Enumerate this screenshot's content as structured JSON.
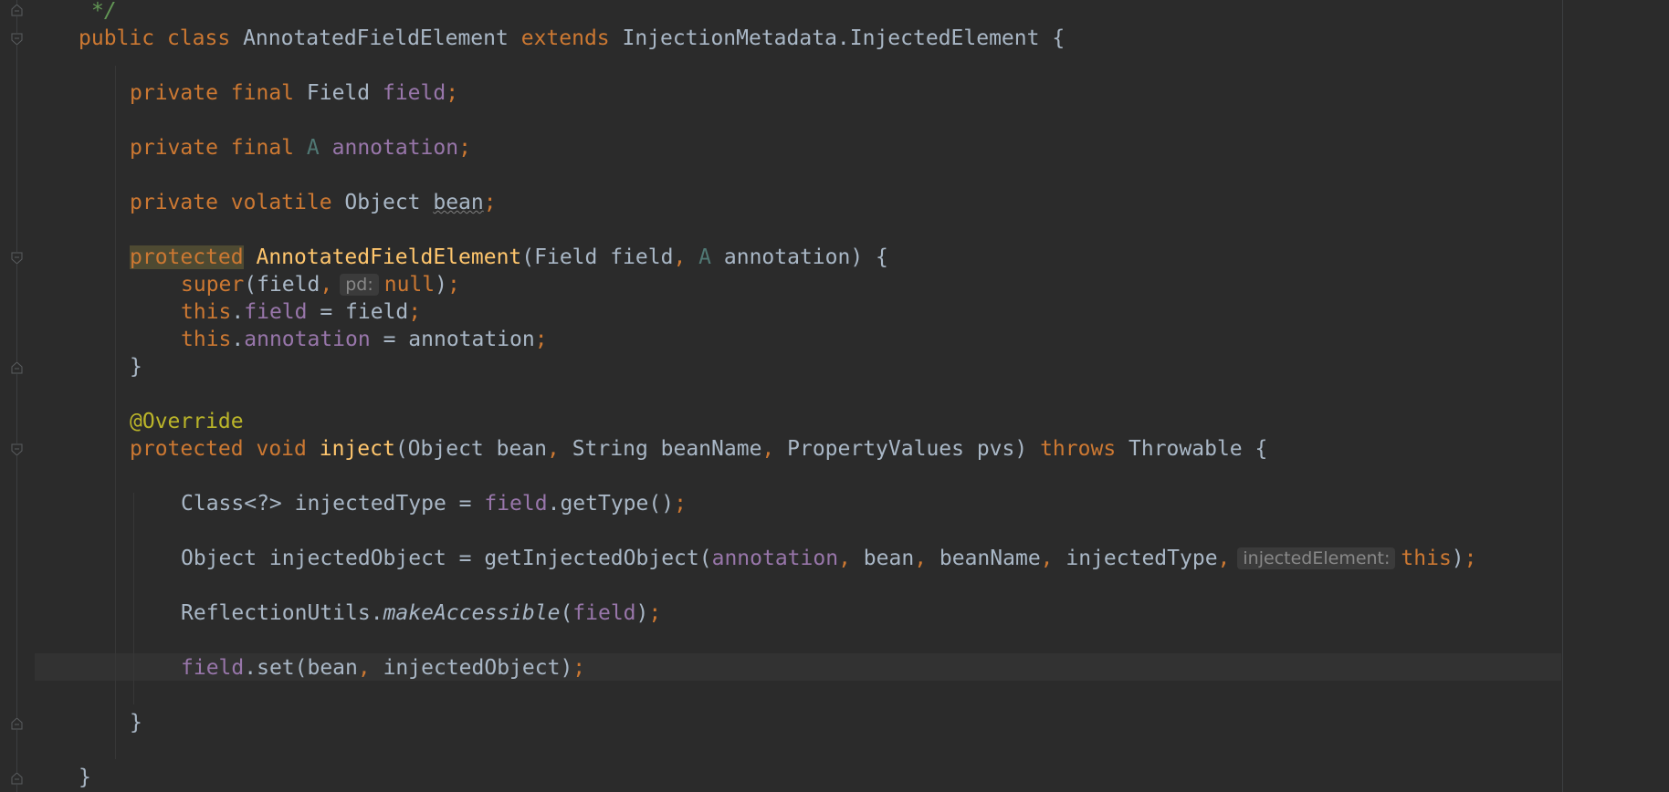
{
  "editor": {
    "lines": [
      {
        "id": "line-comment-end",
        "tokens": [
          {
            "t": "*/",
            "c": "cm"
          }
        ]
      },
      {
        "id": "line-class-decl",
        "tokens": [
          {
            "t": "public",
            "c": "kw"
          },
          {
            "t": " "
          },
          {
            "t": "class",
            "c": "kw"
          },
          {
            "t": " "
          },
          {
            "t": "AnnotatedFieldElement"
          },
          {
            "t": " "
          },
          {
            "t": "extends",
            "c": "kw"
          },
          {
            "t": " "
          },
          {
            "t": "InjectionMetadata.InjectedElement {"
          }
        ]
      },
      {
        "id": "line-field-field",
        "tokens": [
          {
            "t": "private",
            "c": "kw"
          },
          {
            "t": " "
          },
          {
            "t": "final",
            "c": "kw"
          },
          {
            "t": " Field "
          },
          {
            "t": "field",
            "c": "fld"
          },
          {
            "t": ";",
            "c": "kw"
          }
        ]
      },
      {
        "id": "line-field-annotation",
        "tokens": [
          {
            "t": "private",
            "c": "kw"
          },
          {
            "t": " "
          },
          {
            "t": "final",
            "c": "kw"
          },
          {
            "t": " "
          },
          {
            "t": "A",
            "c": "tp"
          },
          {
            "t": " "
          },
          {
            "t": "annotation",
            "c": "fld"
          },
          {
            "t": ";",
            "c": "kw"
          }
        ]
      },
      {
        "id": "line-field-bean",
        "tokens": [
          {
            "t": "private",
            "c": "kw"
          },
          {
            "t": " "
          },
          {
            "t": "volatile",
            "c": "kw"
          },
          {
            "t": " Object "
          },
          {
            "t": "bean",
            "c": "squig"
          },
          {
            "t": ";",
            "c": "kw"
          }
        ]
      },
      {
        "id": "line-constructor-decl",
        "tokens": [
          {
            "t": "protected",
            "c": "kw hl"
          },
          {
            "t": " "
          },
          {
            "t": "AnnotatedFieldElement",
            "c": "fn"
          },
          {
            "t": "(Field field"
          },
          {
            "t": ",",
            "c": "kw"
          },
          {
            "t": " "
          },
          {
            "t": "A",
            "c": "tp"
          },
          {
            "t": " annotation) {"
          }
        ]
      },
      {
        "id": "line-super-call",
        "tokens": [
          {
            "t": "super",
            "c": "kw"
          },
          {
            "t": "(field"
          },
          {
            "t": ",",
            "c": "kw"
          },
          {
            "t": "pd:",
            "hint": true
          },
          {
            "t": "null",
            "c": "kw"
          },
          {
            "t": ")"
          },
          {
            "t": ";",
            "c": "kw"
          }
        ]
      },
      {
        "id": "line-this-field",
        "tokens": [
          {
            "t": "this",
            "c": "kw"
          },
          {
            "t": "."
          },
          {
            "t": "field",
            "c": "fld"
          },
          {
            "t": " = field"
          },
          {
            "t": ";",
            "c": "kw"
          }
        ]
      },
      {
        "id": "line-this-annotation",
        "tokens": [
          {
            "t": "this",
            "c": "kw"
          },
          {
            "t": "."
          },
          {
            "t": "annotation",
            "c": "fld"
          },
          {
            "t": " = annotation"
          },
          {
            "t": ";",
            "c": "kw"
          }
        ]
      },
      {
        "id": "line-constructor-close",
        "tokens": [
          {
            "t": "}"
          }
        ]
      },
      {
        "id": "line-override",
        "tokens": [
          {
            "t": "@Override",
            "c": "ann"
          }
        ]
      },
      {
        "id": "line-inject-decl",
        "tokens": [
          {
            "t": "protected",
            "c": "kw"
          },
          {
            "t": " "
          },
          {
            "t": "void",
            "c": "kw"
          },
          {
            "t": " "
          },
          {
            "t": "inject",
            "c": "fn"
          },
          {
            "t": "(Object bean"
          },
          {
            "t": ",",
            "c": "kw"
          },
          {
            "t": " String beanName"
          },
          {
            "t": ",",
            "c": "kw"
          },
          {
            "t": " PropertyValues pvs) "
          },
          {
            "t": "throws",
            "c": "kw"
          },
          {
            "t": " Throwable {"
          }
        ]
      },
      {
        "id": "line-injected-type",
        "tokens": [
          {
            "t": "Class<?> injectedType = "
          },
          {
            "t": "field",
            "c": "fld"
          },
          {
            "t": ".getType()"
          },
          {
            "t": ";",
            "c": "kw"
          }
        ]
      },
      {
        "id": "line-injected-object",
        "tokens": [
          {
            "t": "Object injectedObject = getInjectedObject("
          },
          {
            "t": "annotation",
            "c": "fld"
          },
          {
            "t": ",",
            "c": "kw"
          },
          {
            "t": " bean"
          },
          {
            "t": ",",
            "c": "kw"
          },
          {
            "t": " beanName"
          },
          {
            "t": ",",
            "c": "kw"
          },
          {
            "t": " injectedType"
          },
          {
            "t": ",",
            "c": "kw"
          },
          {
            "t": "injectedElement:",
            "hint": true
          },
          {
            "t": "this",
            "c": "kw"
          },
          {
            "t": ")"
          },
          {
            "t": ";",
            "c": "kw"
          }
        ]
      },
      {
        "id": "line-make-accessible",
        "tokens": [
          {
            "t": "ReflectionUtils."
          },
          {
            "t": "makeAccessible",
            "c": "it"
          },
          {
            "t": "("
          },
          {
            "t": "field",
            "c": "fld"
          },
          {
            "t": ")"
          },
          {
            "t": ";",
            "c": "kw"
          }
        ]
      },
      {
        "id": "line-field-set",
        "tokens": [
          {
            "t": "field",
            "c": "fld"
          },
          {
            "t": ".set(bean"
          },
          {
            "t": ",",
            "c": "kw"
          },
          {
            "t": " injectedObject)"
          },
          {
            "t": ";",
            "c": "kw"
          }
        ]
      },
      {
        "id": "line-inject-close",
        "tokens": [
          {
            "t": "}"
          }
        ]
      },
      {
        "id": "line-class-close",
        "tokens": [
          {
            "t": "}"
          }
        ]
      }
    ]
  }
}
